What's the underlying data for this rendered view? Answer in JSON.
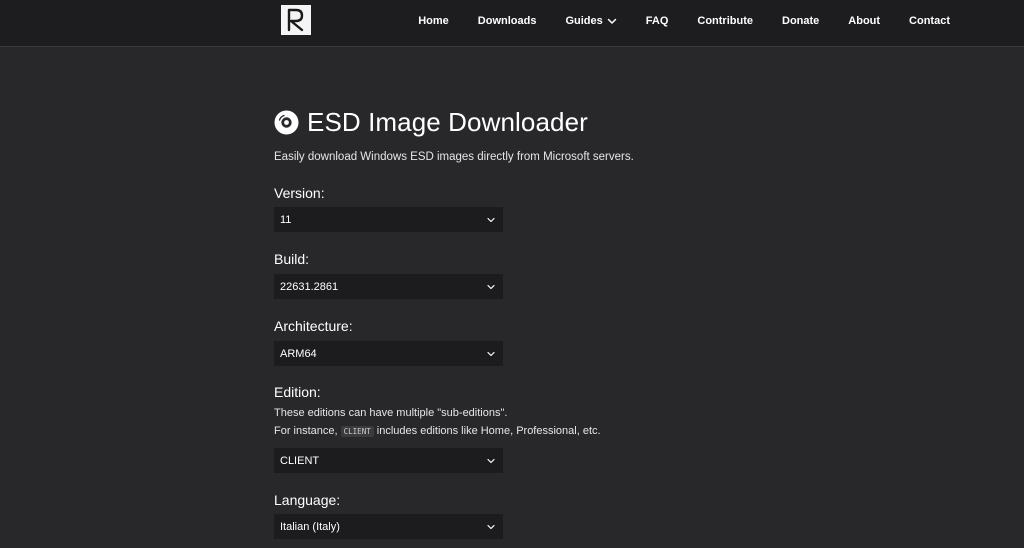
{
  "nav": {
    "logo_letter": "R",
    "links": [
      {
        "label": "Home"
      },
      {
        "label": "Downloads"
      },
      {
        "label": "Guides"
      },
      {
        "label": "FAQ"
      },
      {
        "label": "Contribute"
      },
      {
        "label": "Donate"
      },
      {
        "label": "About"
      },
      {
        "label": "Contact"
      }
    ]
  },
  "page": {
    "title": "ESD Image Downloader",
    "subtitle": "Easily download Windows ESD images directly from Microsoft servers."
  },
  "form": {
    "version": {
      "label": "Version:",
      "value": "11"
    },
    "build": {
      "label": "Build:",
      "value": "22631.2861"
    },
    "architecture": {
      "label": "Architecture:",
      "value": "ARM64"
    },
    "edition": {
      "label": "Edition:",
      "help_line1": "These editions can have multiple \"sub-editions\".",
      "help_line2_prefix": "For instance, ",
      "help_code": "CLIENT",
      "help_line2_suffix": " includes editions like Home, Professional, etc.",
      "value": "CLIENT"
    },
    "language": {
      "label": "Language:",
      "value": "Italian (Italy)"
    }
  },
  "colors": {
    "background": "#28282b",
    "navbar": "#1d1d20",
    "select_bg": "#1c1c1f"
  }
}
